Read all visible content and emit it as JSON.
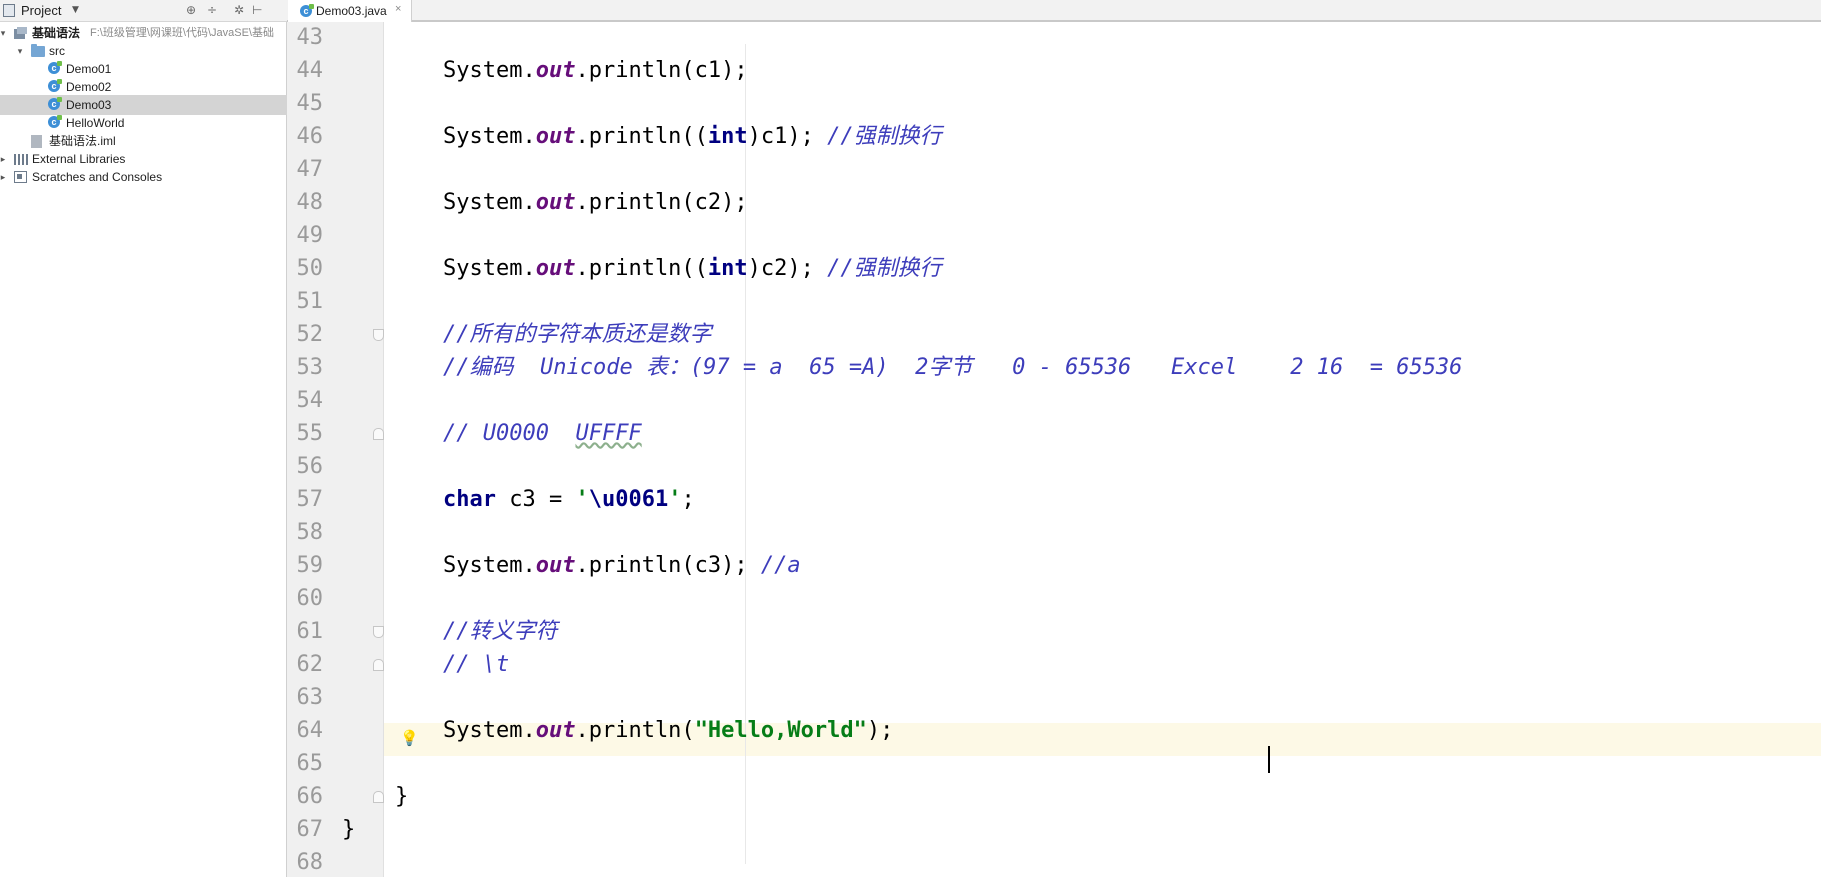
{
  "project_panel": {
    "title": "Project",
    "tree": [
      {
        "label": "基础语法",
        "path": "F:\\班级管理\\网课班\\代码\\JavaSE\\基础",
        "type": "module",
        "indent": 0,
        "arrow": "▾",
        "bold": true
      },
      {
        "label": "src",
        "type": "folder",
        "indent": 1,
        "arrow": "▾"
      },
      {
        "label": "Demo01",
        "type": "class",
        "indent": 2
      },
      {
        "label": "Demo02",
        "type": "class",
        "indent": 2
      },
      {
        "label": "Demo03",
        "type": "class",
        "indent": 2,
        "selected": true
      },
      {
        "label": "HelloWorld",
        "type": "class",
        "indent": 2
      },
      {
        "label": "基础语法.iml",
        "type": "iml",
        "indent": 1
      },
      {
        "label": "External Libraries",
        "type": "libs",
        "indent": 0,
        "arrow": "▸"
      },
      {
        "label": "Scratches and Consoles",
        "type": "scratch",
        "indent": 0,
        "arrow": "▸"
      }
    ]
  },
  "tab": {
    "label": "Demo03.java",
    "close_glyph": "×"
  },
  "editor": {
    "lines": [
      {
        "n": "43",
        "tokens": []
      },
      {
        "n": "44",
        "tokens": [
          [
            "t",
            "System."
          ],
          [
            "fld",
            "out"
          ],
          [
            "t",
            ".println(c1);"
          ]
        ]
      },
      {
        "n": "45",
        "tokens": []
      },
      {
        "n": "46",
        "tokens": [
          [
            "t",
            "System."
          ],
          [
            "fld",
            "out"
          ],
          [
            "t",
            ".println(("
          ],
          [
            "kw",
            "int"
          ],
          [
            "t",
            ")c1); "
          ],
          [
            "cm",
            "//强制换行"
          ]
        ]
      },
      {
        "n": "47",
        "tokens": []
      },
      {
        "n": "48",
        "tokens": [
          [
            "t",
            "System."
          ],
          [
            "fld",
            "out"
          ],
          [
            "t",
            ".println(c2);"
          ]
        ]
      },
      {
        "n": "49",
        "tokens": []
      },
      {
        "n": "50",
        "tokens": [
          [
            "t",
            "System."
          ],
          [
            "fld",
            "out"
          ],
          [
            "t",
            ".println(("
          ],
          [
            "kw",
            "int"
          ],
          [
            "t",
            ")c2); "
          ],
          [
            "cm",
            "//强制换行"
          ]
        ]
      },
      {
        "n": "51",
        "tokens": []
      },
      {
        "n": "52",
        "tokens": [
          [
            "cm",
            "//所有的字符本质还是数字"
          ]
        ]
      },
      {
        "n": "53",
        "tokens": [
          [
            "cm",
            "//编码  Unicode 表：(97 = a  65 =A)  2字节   0 - 65536   Excel    2 16  = 65536"
          ]
        ]
      },
      {
        "n": "54",
        "tokens": []
      },
      {
        "n": "55",
        "tokens": [
          [
            "cm",
            "// U0000  "
          ],
          [
            "cmw",
            "UFFFF"
          ]
        ]
      },
      {
        "n": "56",
        "tokens": []
      },
      {
        "n": "57",
        "tokens": [
          [
            "kw",
            "char"
          ],
          [
            "t",
            " c3 = "
          ],
          [
            "str",
            "'"
          ],
          [
            "esc",
            "\\u0061"
          ],
          [
            "str",
            "'"
          ],
          [
            "t",
            ";"
          ]
        ]
      },
      {
        "n": "58",
        "tokens": []
      },
      {
        "n": "59",
        "tokens": [
          [
            "t",
            "System."
          ],
          [
            "fld",
            "out"
          ],
          [
            "t",
            ".println(c3); "
          ],
          [
            "cm",
            "//a"
          ]
        ]
      },
      {
        "n": "60",
        "tokens": []
      },
      {
        "n": "61",
        "tokens": [
          [
            "cm",
            "//转义字符"
          ]
        ]
      },
      {
        "n": "62",
        "tokens": [
          [
            "cm",
            "// \\t"
          ]
        ]
      },
      {
        "n": "63",
        "tokens": []
      },
      {
        "n": "64",
        "tokens": [
          [
            "t",
            "System."
          ],
          [
            "fld",
            "out"
          ],
          [
            "t",
            ".println("
          ],
          [
            "str",
            "\"Hello,World\""
          ],
          [
            "t",
            ");"
          ]
        ]
      },
      {
        "n": "65",
        "tokens": []
      },
      {
        "n": "66",
        "tokens": [
          [
            "t",
            "}"
          ]
        ]
      },
      {
        "n": "67",
        "tokens": [
          [
            "t",
            "}"
          ]
        ]
      },
      {
        "n": "68",
        "tokens": []
      }
    ]
  },
  "colors": {
    "keyword": "#000080",
    "field": "#660e7a",
    "comment": "#3d3dbb",
    "string": "#067d17",
    "caret_line": "#fdf9e6"
  }
}
